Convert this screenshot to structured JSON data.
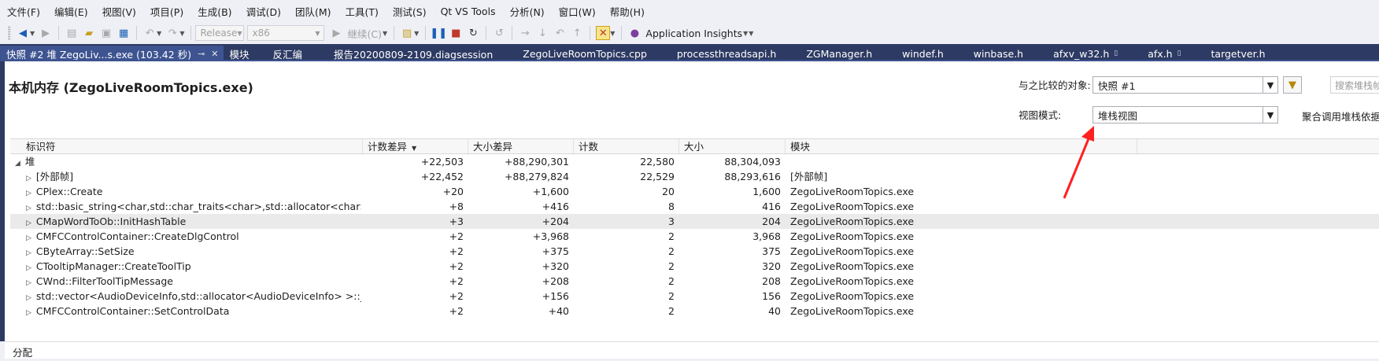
{
  "menu": [
    "文件(F)",
    "编辑(E)",
    "视图(V)",
    "项目(P)",
    "生成(B)",
    "调试(D)",
    "团队(M)",
    "工具(T)",
    "测试(S)",
    "Qt VS Tools",
    "分析(N)",
    "窗口(W)",
    "帮助(H)"
  ],
  "toolbar": {
    "config": "Release",
    "platform": "x86",
    "continue": "继续(C)",
    "insights": "Application Insights"
  },
  "tabs": {
    "active": "快照 #2 堆 ZegoLiv...s.exe (103.42 秒)",
    "others": [
      "模块",
      "反汇编",
      "报告20200809-2109.diagsession",
      "ZegoLiveRoomTopics.cpp",
      "processthreadsapi.h",
      "ZGManager.h",
      "windef.h",
      "winbase.h",
      "afxv_w32.h",
      "afx.h",
      "targetver.h"
    ]
  },
  "page": {
    "title": "本机内存 (ZegoLiveRoomTopics.exe)",
    "compare_label": "与之比较的对象:",
    "compare_value": "快照 #1",
    "search_placeholder": "搜索堆栈帧",
    "view_label": "视图模式:",
    "view_value": "堆栈视图",
    "aggregate_label": "聚合调用堆栈依据"
  },
  "grid": {
    "columns": [
      "标识符",
      "计数差异",
      "大小差异",
      "计数",
      "大小",
      "模块"
    ],
    "rows": [
      {
        "id": "堆",
        "count_diff": "+22,503",
        "size_diff": "+88,290,301",
        "count": "22,580",
        "size": "88,304,093",
        "module": ""
      },
      {
        "id": "[外部帧]",
        "count_diff": "+22,452",
        "size_diff": "+88,279,824",
        "count": "22,529",
        "size": "88,293,616",
        "module": "[外部帧]"
      },
      {
        "id": "CPlex::Create",
        "count_diff": "+20",
        "size_diff": "+1,600",
        "count": "20",
        "size": "1,600",
        "module": "ZegoLiveRoomTopics.exe"
      },
      {
        "id": "std::basic_string<char,std::char_traits<char>,std::allocator<char> >::_Copy",
        "count_diff": "+8",
        "size_diff": "+416",
        "count": "8",
        "size": "416",
        "module": "ZegoLiveRoomTopics.exe"
      },
      {
        "id": "CMapWordToOb::InitHashTable",
        "count_diff": "+3",
        "size_diff": "+204",
        "count": "3",
        "size": "204",
        "module": "ZegoLiveRoomTopics.exe"
      },
      {
        "id": "CMFCControlContainer::CreateDlgControl",
        "count_diff": "+2",
        "size_diff": "+3,968",
        "count": "2",
        "size": "3,968",
        "module": "ZegoLiveRoomTopics.exe"
      },
      {
        "id": "CByteArray::SetSize",
        "count_diff": "+2",
        "size_diff": "+375",
        "count": "2",
        "size": "375",
        "module": "ZegoLiveRoomTopics.exe"
      },
      {
        "id": "CTooltipManager::CreateToolTip",
        "count_diff": "+2",
        "size_diff": "+320",
        "count": "2",
        "size": "320",
        "module": "ZegoLiveRoomTopics.exe"
      },
      {
        "id": "CWnd::FilterToolTipMessage",
        "count_diff": "+2",
        "size_diff": "+208",
        "count": "2",
        "size": "208",
        "module": "ZegoLiveRoomTopics.exe"
      },
      {
        "id": "std::vector<AudioDeviceInfo,std::allocator<AudioDeviceInfo> >::_Reallocate",
        "count_diff": "+2",
        "size_diff": "+156",
        "count": "2",
        "size": "156",
        "module": "ZegoLiveRoomTopics.exe"
      },
      {
        "id": "CMFCControlContainer::SetControlData",
        "count_diff": "+2",
        "size_diff": "+40",
        "count": "2",
        "size": "40",
        "module": "ZegoLiveRoomTopics.exe"
      }
    ]
  },
  "bottom": {
    "label": "分配"
  },
  "colors": {
    "tab_strip": "#2d3a63",
    "active_tab": "#3e5491",
    "annotation_arrow": "#ff2020"
  }
}
